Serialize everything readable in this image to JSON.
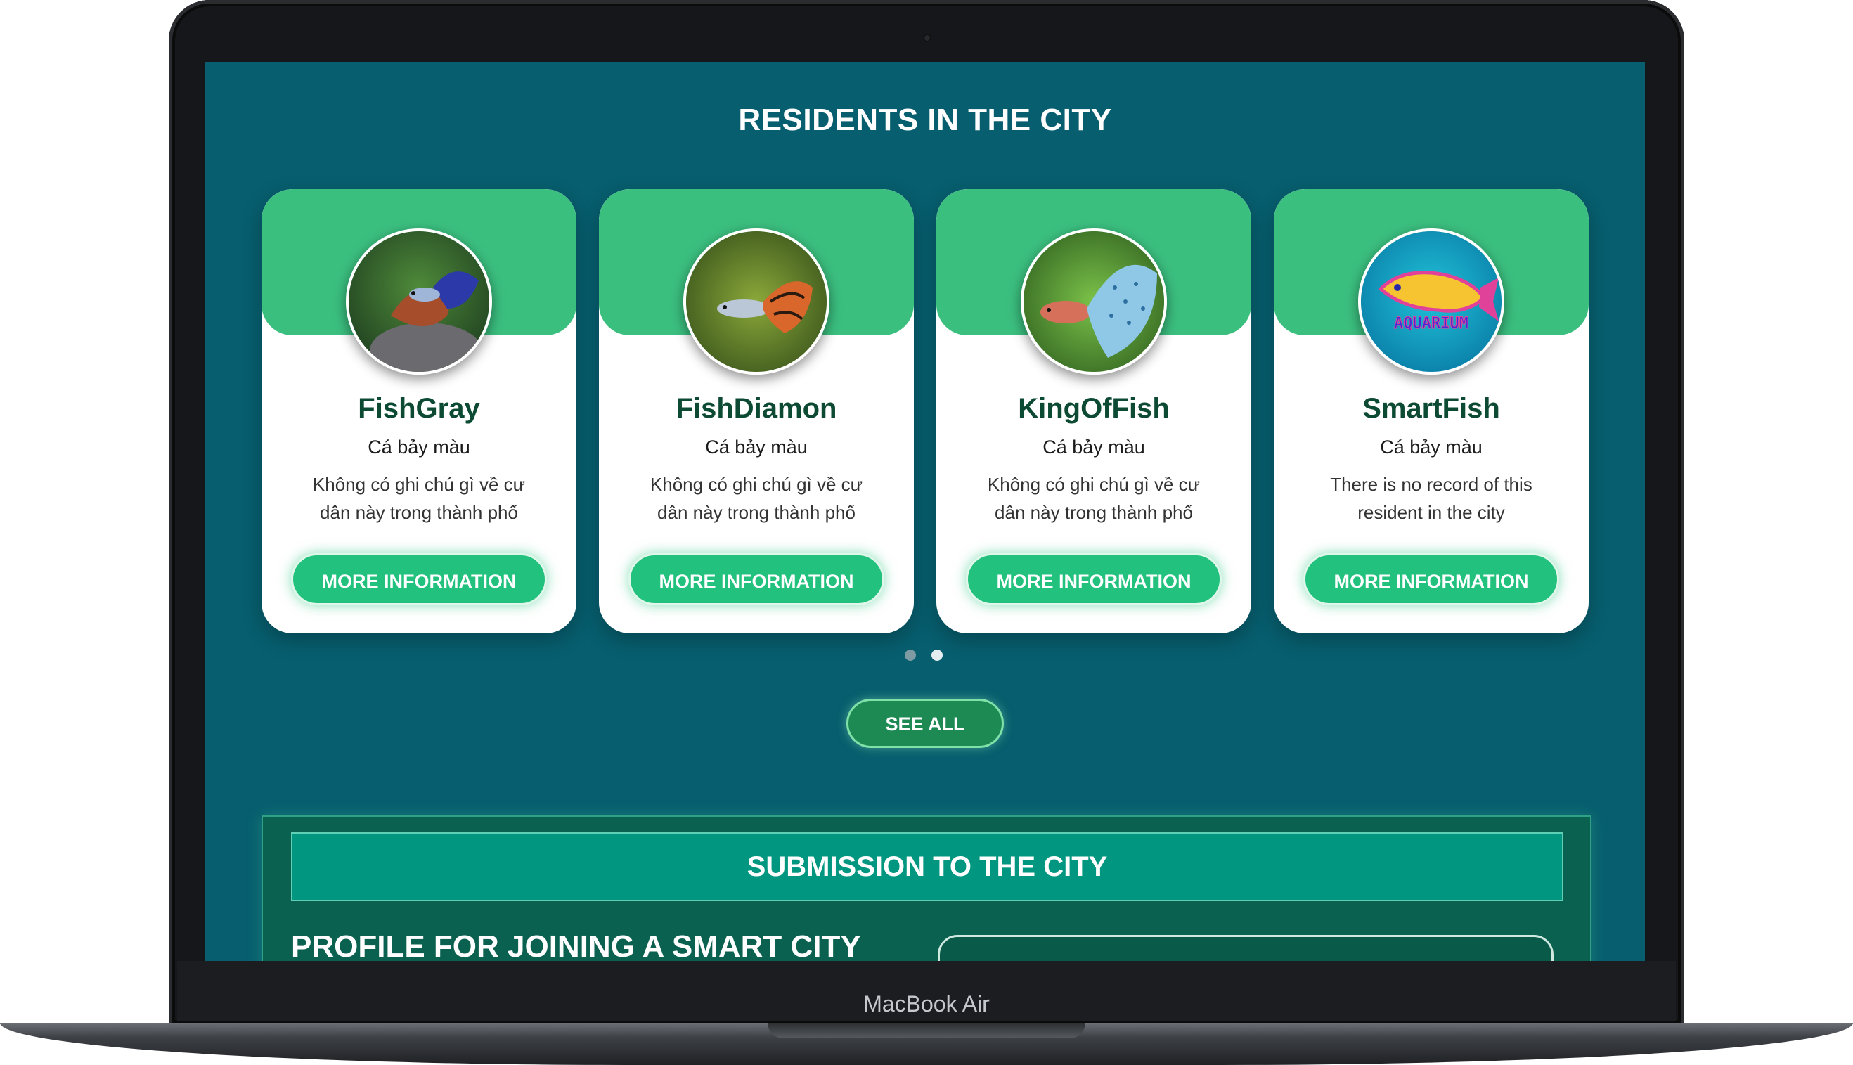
{
  "device": {
    "label": "MacBook Air"
  },
  "residents": {
    "title": "RESIDENTS IN THE CITY",
    "cards": [
      {
        "name": "FishGray",
        "species": "Cá bảy màu",
        "note": "Không có ghi chú gì về cư dân này trong thành phố",
        "button": "MORE INFORMATION",
        "avatar_icon": "guppy-photo-icon"
      },
      {
        "name": "FishDiamon",
        "species": "Cá bảy màu",
        "note": "Không có ghi chú gì về cư dân này trong thành phố",
        "button": "MORE INFORMATION",
        "avatar_icon": "guppy-photo-icon"
      },
      {
        "name": "KingOfFish",
        "species": "Cá bảy màu",
        "note": "Không có ghi chú gì về cư dân này trong thành phố",
        "button": "MORE INFORMATION",
        "avatar_icon": "guppy-photo-icon"
      },
      {
        "name": "SmartFish",
        "species": "Cá bảy màu",
        "note": "There is no record of this resident in the city",
        "button": "MORE INFORMATION",
        "avatar_icon": "aquarium-logo-icon",
        "logo_text": "AQUARIUM"
      }
    ],
    "pagination": {
      "pages": 2,
      "active": 2
    },
    "see_all": "SEE ALL"
  },
  "submission": {
    "title": "SUBMISSION TO THE CITY",
    "profile_title": "PROFILE FOR JOINING A SMART CITY"
  },
  "colors": {
    "page_bg": "#075e6e",
    "card_header": "#3bbf7f",
    "button": "#22c27e",
    "name_text": "#0c4a33",
    "see_all_bg": "#1d8a54",
    "submission_bar": "#00967f"
  }
}
